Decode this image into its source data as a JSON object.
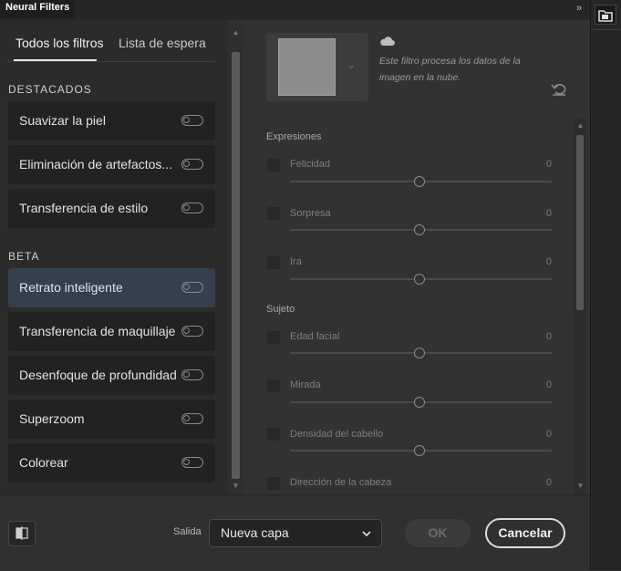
{
  "window": {
    "title": "Neural Filters",
    "collapse_glyph": "»"
  },
  "tabs": {
    "all": "Todos los filtros",
    "waitlist": "Lista de espera"
  },
  "sections": {
    "featured": {
      "title": "DESTACADOS",
      "items": [
        {
          "label": "Suavizar la piel",
          "enabled": false
        },
        {
          "label": "Eliminación de artefactos...",
          "enabled": false
        },
        {
          "label": "Transferencia de estilo",
          "enabled": false
        }
      ]
    },
    "beta": {
      "title": "BETA",
      "items": [
        {
          "label": "Retrato inteligente",
          "enabled": false,
          "selected": true
        },
        {
          "label": "Transferencia de maquillaje",
          "enabled": false
        },
        {
          "label": "Desenfoque de profundidad",
          "enabled": false
        },
        {
          "label": "Superzoom",
          "enabled": false
        },
        {
          "label": "Colorear",
          "enabled": false
        }
      ]
    }
  },
  "preview": {
    "cloud_note": "Este filtro procesa los datos de la imagen en la nube."
  },
  "groups": {
    "expressions": {
      "title": "Expresiones",
      "sliders": [
        {
          "label": "Felicidad",
          "value": "0"
        },
        {
          "label": "Sorpresa",
          "value": "0"
        },
        {
          "label": "Ira",
          "value": "0"
        }
      ]
    },
    "subject": {
      "title": "Sujeto",
      "sliders": [
        {
          "label": "Edad facial",
          "value": "0"
        },
        {
          "label": "Mirada",
          "value": "0"
        },
        {
          "label": "Densidad del cabello",
          "value": "0"
        },
        {
          "label": "Dirección de la cabeza",
          "value": "0"
        }
      ]
    }
  },
  "footer": {
    "output_label": "Salida",
    "output_value": "Nueva capa",
    "ok_label": "OK",
    "cancel_label": "Cancelar"
  },
  "colors": {
    "background": "#323232",
    "selected_card": "#35404f",
    "card": "#222222"
  }
}
